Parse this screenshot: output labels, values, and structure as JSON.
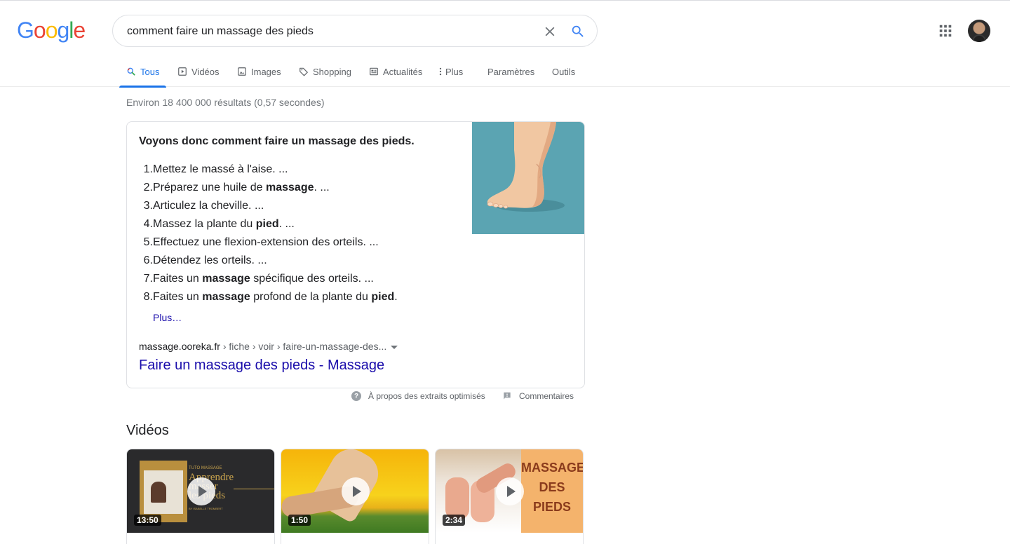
{
  "logo": [
    "G",
    "o",
    "o",
    "g",
    "l",
    "e"
  ],
  "logo_colors": [
    "#4285f4",
    "#ea4335",
    "#fbbc05",
    "#4285f4",
    "#34a853",
    "#ea4335"
  ],
  "search": {
    "query": "comment faire un massage des pieds"
  },
  "tabs": [
    {
      "label": "Tous",
      "icon": "search-icon",
      "active": true
    },
    {
      "label": "Vidéos",
      "icon": "video-icon"
    },
    {
      "label": "Images",
      "icon": "image-icon"
    },
    {
      "label": "Shopping",
      "icon": "tag-icon"
    },
    {
      "label": "Actualités",
      "icon": "news-icon"
    },
    {
      "label": "Plus",
      "icon": "more-vert-icon"
    },
    {
      "label": "Paramètres"
    },
    {
      "label": "Outils"
    }
  ],
  "result_stats": "Environ 18 400 000 résultats (0,57 secondes)",
  "snippet": {
    "title": "Voyons donc comment faire un massage des pieds.",
    "steps": [
      [
        {
          "t": "Mettez le massé à l'aise. ..."
        }
      ],
      [
        {
          "t": "Préparez une huile de "
        },
        {
          "t": "massage",
          "b": true
        },
        {
          "t": ". ..."
        }
      ],
      [
        {
          "t": "Articulez la cheville. ..."
        }
      ],
      [
        {
          "t": "Massez la plante du "
        },
        {
          "t": "pied",
          "b": true
        },
        {
          "t": ". ..."
        }
      ],
      [
        {
          "t": "Effectuez une flexion-extension des orteils. ..."
        }
      ],
      [
        {
          "t": "Détendez les orteils. ..."
        }
      ],
      [
        {
          "t": "Faites un "
        },
        {
          "t": "massage",
          "b": true
        },
        {
          "t": " spécifique des orteils. ..."
        }
      ],
      [
        {
          "t": "Faites un "
        },
        {
          "t": "massage",
          "b": true
        },
        {
          "t": " profond de la plante du "
        },
        {
          "t": "pied",
          "b": true
        },
        {
          "t": "."
        }
      ]
    ],
    "more": "Plus…",
    "cite_domain": "massage.ooreka.fr",
    "cite_path": " › fiche › voir › faire-un-massage-des...",
    "link": "Faire un massage des pieds - Massage"
  },
  "footer": {
    "about": "À propos des extraits optimisés",
    "feedback": "Commentaires"
  },
  "videos": {
    "heading": "Vidéos",
    "items": [
      {
        "duration": "13:50",
        "thumb_texts": [
          "TUTO MASSAGE",
          "Apprendre",
          "masser",
          "les pieds",
          "BY ISABELLE TROMBERT"
        ]
      },
      {
        "duration": "1:50"
      },
      {
        "duration": "2:34",
        "thumb_texts": [
          "MASSAGE",
          "DES",
          "PIEDS"
        ]
      }
    ]
  }
}
